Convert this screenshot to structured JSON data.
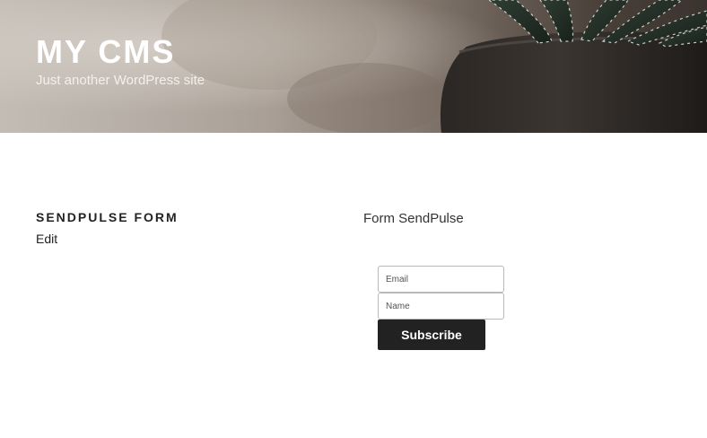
{
  "header": {
    "site_title": "MY CMS",
    "tagline": "Just another WordPress site"
  },
  "main": {
    "page_title": "SENDPULSE FORM",
    "edit_label": "Edit",
    "form": {
      "title": "Form SendPulse",
      "email_placeholder": "Email",
      "name_placeholder": "Name",
      "submit_label": "Subscribe"
    }
  },
  "colors": {
    "button_bg": "#222222",
    "text": "#222222",
    "header_title": "#ffffff"
  }
}
